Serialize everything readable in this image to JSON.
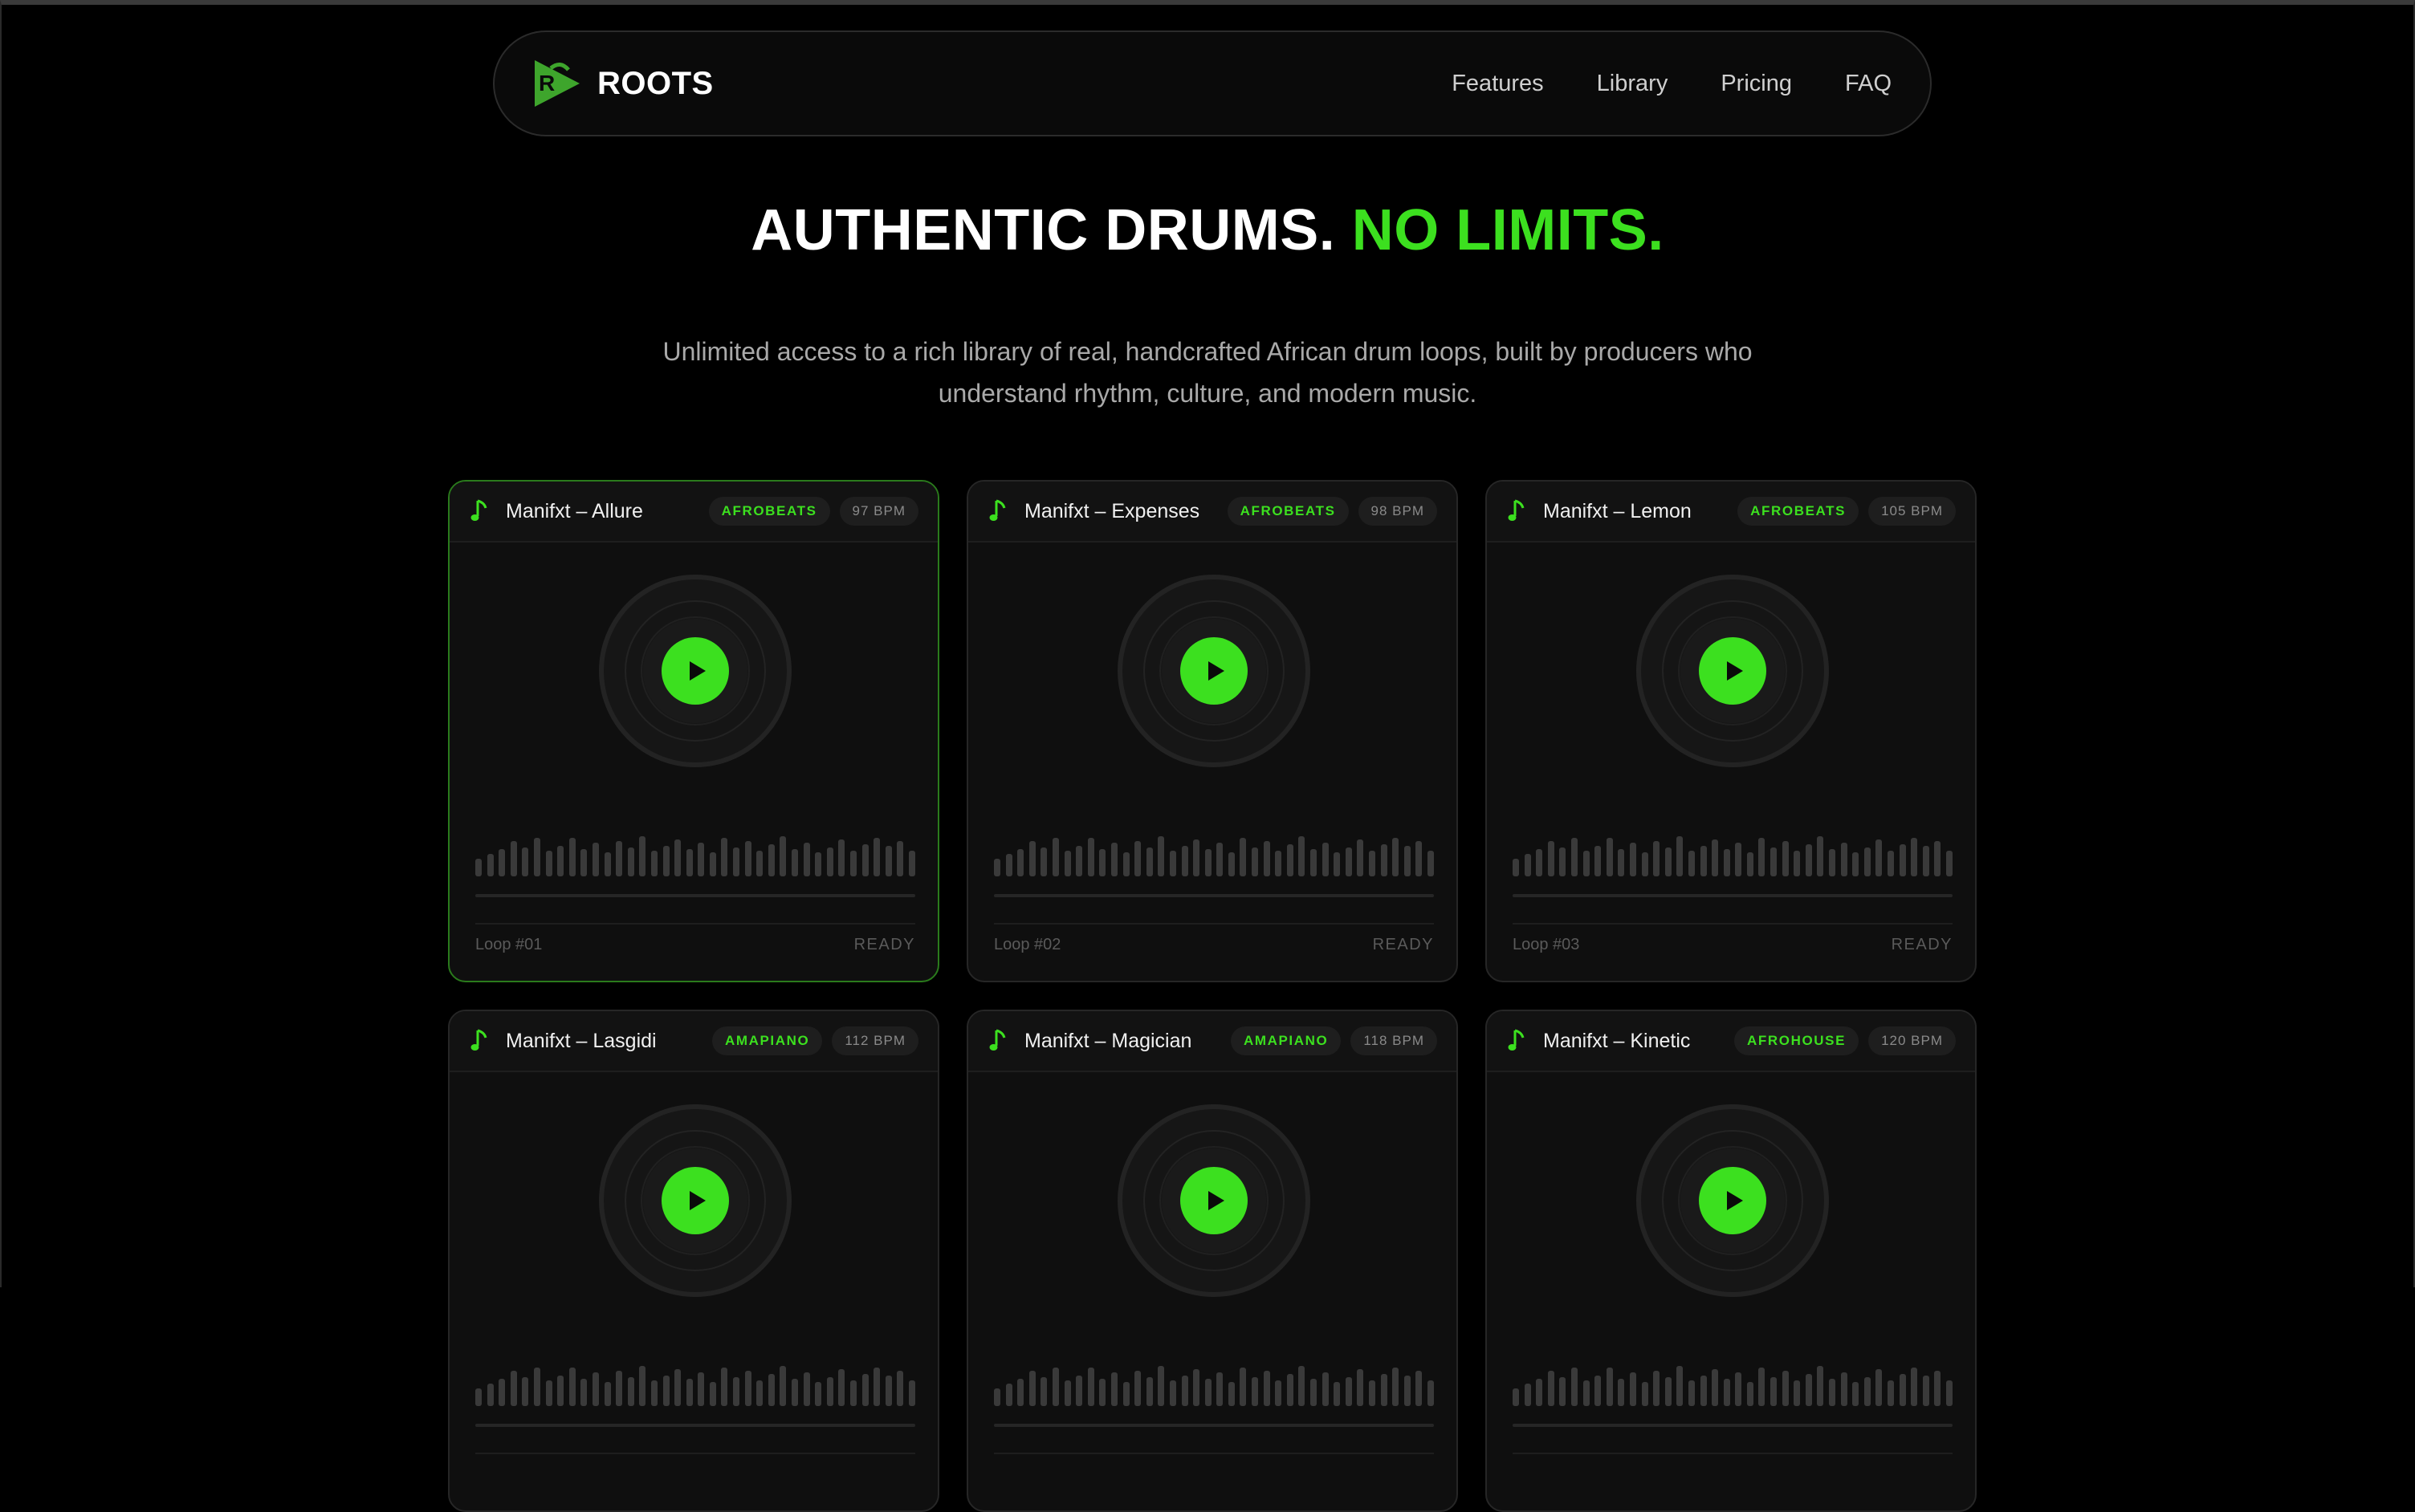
{
  "nav": {
    "brand": "ROOTS",
    "logo_letter": "R",
    "links": [
      "Features",
      "Library",
      "Pricing",
      "FAQ"
    ]
  },
  "hero": {
    "title_white": "AUTHENTIC DRUMS.",
    "title_green": "NO LIMITS.",
    "subtitle": "Unlimited access to a rich library of real, handcrafted African drum loops, built by producers who understand rhythm, culture, and modern music."
  },
  "colors": {
    "accent": "#3ce01f",
    "background": "#000000",
    "card": "#0f0f0f"
  },
  "loops": [
    {
      "title": "Manifxt – Allure",
      "genre": "AFROBEATS",
      "bpm": "97 BPM",
      "loop": "Loop #01",
      "status": "READY",
      "active": true
    },
    {
      "title": "Manifxt – Expenses",
      "genre": "AFROBEATS",
      "bpm": "98 BPM",
      "loop": "Loop #02",
      "status": "READY"
    },
    {
      "title": "Manifxt – Lemon",
      "genre": "AFROBEATS",
      "bpm": "105 BPM",
      "loop": "Loop #03",
      "status": "READY"
    },
    {
      "title": "Manifxt – Lasgidi",
      "genre": "AMAPIANO",
      "bpm": "112 BPM"
    },
    {
      "title": "Manifxt – Magician",
      "genre": "AMAPIANO",
      "bpm": "118 BPM"
    },
    {
      "title": "Manifxt – Kinetic",
      "genre": "AFROHOUSE",
      "bpm": "120 BPM"
    }
  ]
}
